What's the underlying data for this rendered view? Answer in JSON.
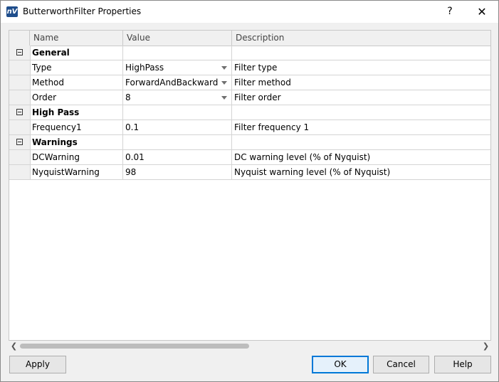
{
  "window": {
    "title": "ButterworthFilter Properties",
    "icon_label": "nV",
    "help_glyph": "?",
    "close_glyph": "✕"
  },
  "grid": {
    "headers": {
      "name": "Name",
      "value": "Value",
      "description": "Description"
    },
    "categories": [
      {
        "label": "General",
        "rows": [
          {
            "name": "Type",
            "value": "HighPass",
            "description": "Filter type",
            "dropdown": true
          },
          {
            "name": "Method",
            "value": "ForwardAndBackward",
            "description": "Filter method",
            "dropdown": true
          },
          {
            "name": "Order",
            "value": "8",
            "description": "Filter order",
            "dropdown": true
          }
        ]
      },
      {
        "label": "High Pass",
        "rows": [
          {
            "name": "Frequency1",
            "value": "0.1",
            "description": "Filter frequency 1",
            "dropdown": false
          }
        ]
      },
      {
        "label": "Warnings",
        "rows": [
          {
            "name": "DCWarning",
            "value": "0.01",
            "description": "DC warning level (% of Nyquist)",
            "dropdown": false
          },
          {
            "name": "NyquistWarning",
            "value": "98",
            "description": "Nyquist warning level (% of Nyquist)",
            "dropdown": false
          }
        ]
      }
    ]
  },
  "scrollbar": {
    "left_glyph": "❮",
    "right_glyph": "❯"
  },
  "buttons": {
    "apply": "Apply",
    "ok": "OK",
    "cancel": "Cancel",
    "help": "Help"
  }
}
